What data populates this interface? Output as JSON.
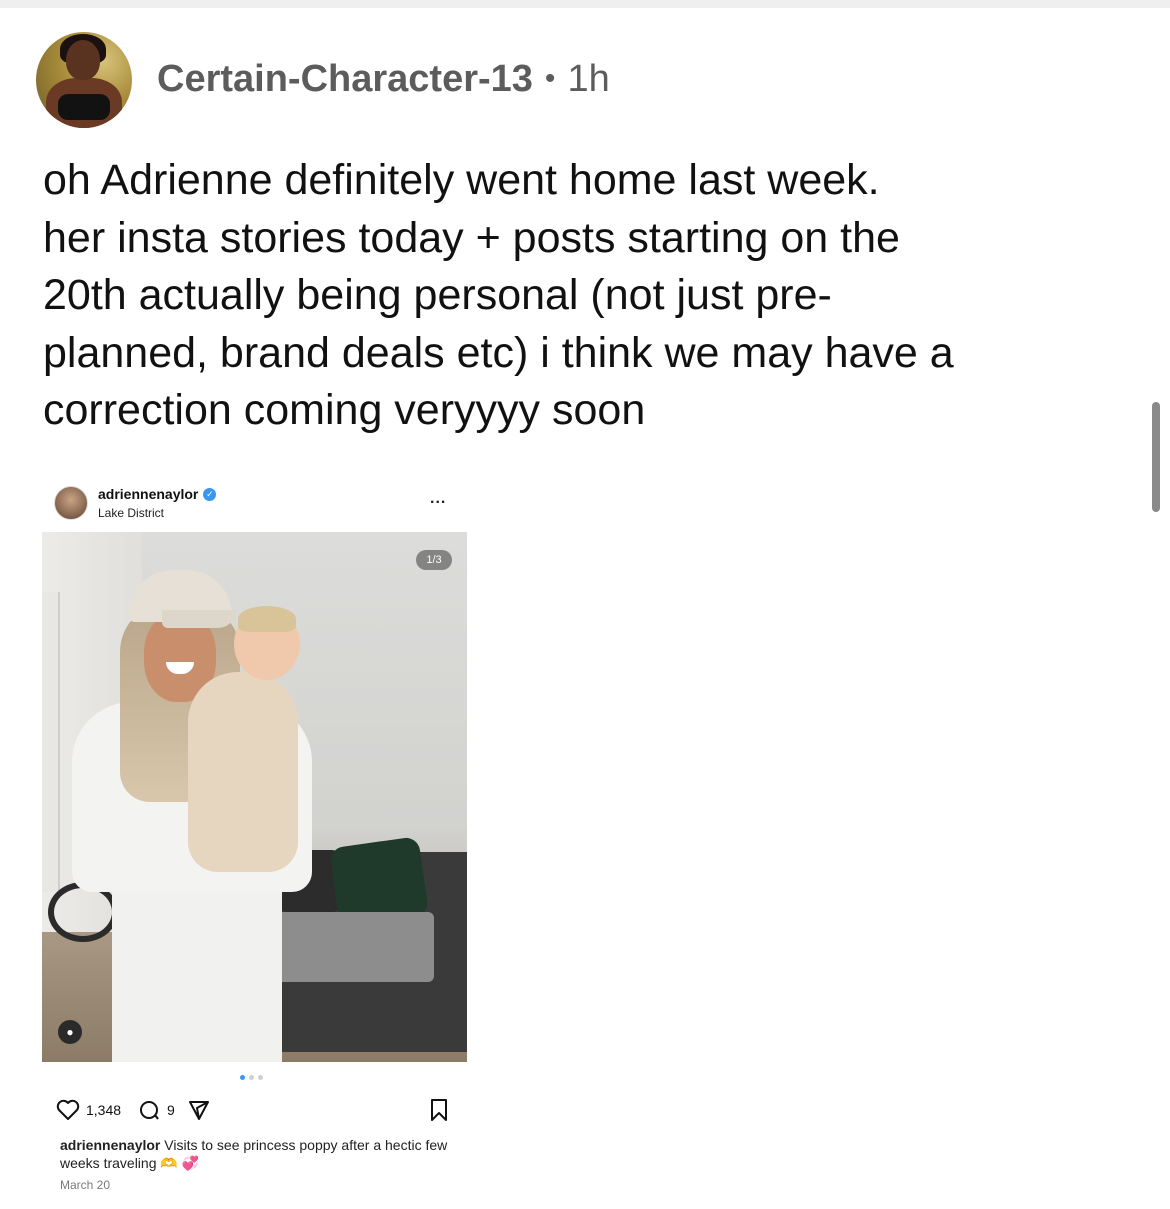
{
  "post": {
    "username": "Certain-Character-13",
    "separator": "•",
    "time": "1h",
    "body_lines": [
      "oh Adrienne definitely went home last week.",
      "her insta stories today + posts starting on the",
      "20th actually being personal (not just pre-",
      "planned, brand deals etc) i think we may have a",
      "correction coming veryyyy soon"
    ]
  },
  "embed": {
    "username": "adriennenaylor",
    "location": "Lake District",
    "more": "...",
    "counter": "1/3",
    "likes": "1,348",
    "comments": "9",
    "caption_user": "adriennenaylor",
    "caption_text": "Visits to see princess poppy after a hectic few weeks traveling 🫶 💞",
    "date": "March 20"
  },
  "icons": [
    "avatar",
    "verified-icon",
    "more-icon",
    "heart-icon",
    "comment-icon",
    "share-icon",
    "bookmark-icon",
    "tag-icon"
  ],
  "colors": {
    "username_gray": "#5c5c5c",
    "verified_blue": "#3897f0",
    "scrollbar": "#8a8a8a"
  }
}
